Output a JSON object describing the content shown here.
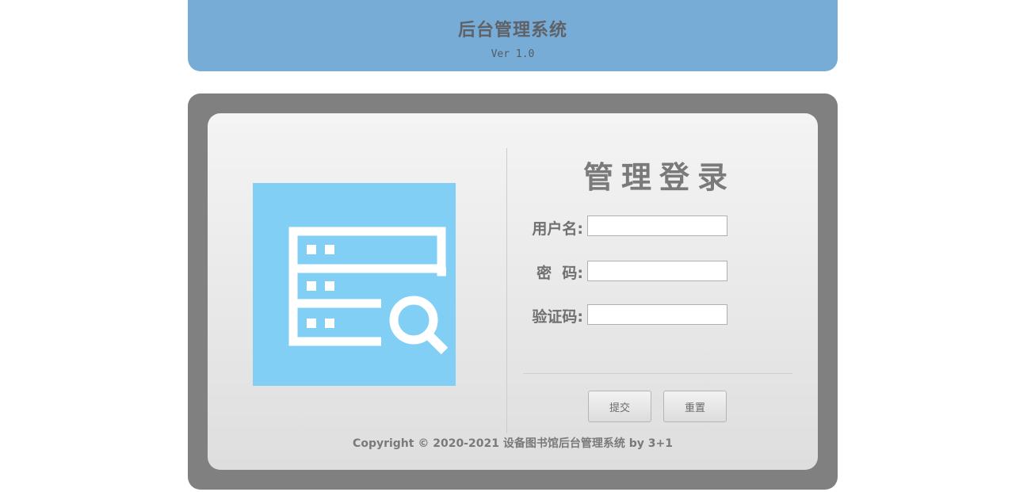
{
  "header": {
    "title": "后台管理系统",
    "version": "Ver 1.0"
  },
  "logo": {
    "icon": "server-search-icon",
    "background": "#81cff5"
  },
  "login": {
    "title": "管理登录",
    "fields": [
      {
        "label": "用户名:",
        "value": "",
        "placeholder": ""
      },
      {
        "label": "密  码:",
        "value": "",
        "placeholder": ""
      },
      {
        "label": "验证码:",
        "value": "",
        "placeholder": ""
      }
    ],
    "submit_label": "提交",
    "reset_label": "重置"
  },
  "footer": {
    "copyright": "Copyright © 2020-2021 设备图书馆后台管理系统 by 3+1"
  },
  "colors": {
    "header_bg": "#77acd6",
    "frame_bg": "#808080",
    "logo_bg": "#81cff5"
  }
}
